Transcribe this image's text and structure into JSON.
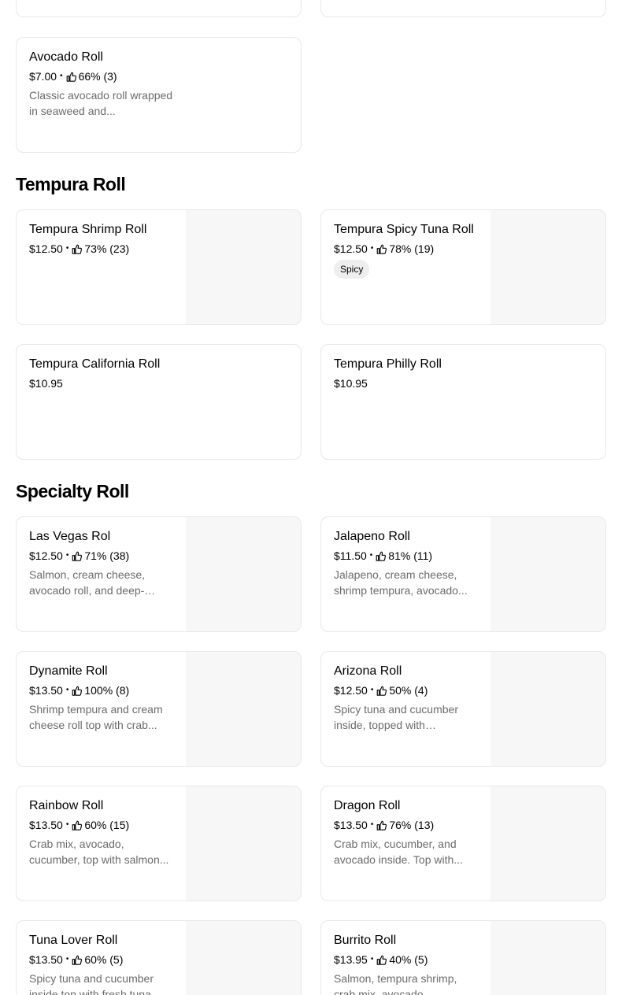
{
  "icons": {
    "rating": "thumbs-up-icon"
  },
  "top_partial_cards": [
    {},
    {}
  ],
  "prev_section_items": [
    {
      "name": "Avocado Roll",
      "price": "$7.00",
      "rating": "66% (3)",
      "description": "Classic avocado roll wrapped in seaweed and..."
    }
  ],
  "sections": [
    {
      "title": "Tempura Roll",
      "items": [
        {
          "name": "Tempura Shrimp Roll",
          "price": "$12.50",
          "rating": "73% (23)"
        },
        {
          "name": "Tempura Spicy Tuna Roll",
          "price": "$12.50",
          "rating": "78% (19)",
          "tag": "Spicy"
        },
        {
          "name": "Tempura California Roll",
          "price": "$10.95"
        },
        {
          "name": "Tempura Philly Roll",
          "price": "$10.95"
        }
      ]
    },
    {
      "title": "Specialty Roll",
      "items": [
        {
          "name": "Las Vegas Rol",
          "price": "$12.50",
          "rating": "71% (38)",
          "description": "Salmon, cream cheese, avocado roll, and deep-fried..."
        },
        {
          "name": "Jalapeno Roll",
          "price": "$11.50",
          "rating": "81% (11)",
          "description": "Jalapeno, cream cheese, shrimp tempura, avocado..."
        },
        {
          "name": "Dynamite Roll",
          "price": "$13.50",
          "rating": "100% (8)",
          "description": "Shrimp tempura and cream cheese roll top with crab..."
        },
        {
          "name": "Arizona Roll",
          "price": "$12.50",
          "rating": "50% (4)",
          "description": "Spicy tuna and cucumber inside, topped with avocado..."
        },
        {
          "name": "Rainbow Roll",
          "price": "$13.50",
          "rating": "60% (15)",
          "description": "Crab mix, avocado, cucumber, top with salmon..."
        },
        {
          "name": "Dragon Roll",
          "price": "$13.50",
          "rating": "76% (13)",
          "description": "Crab mix, cucumber, and avocado inside. Top with..."
        },
        {
          "name": "Tuna Lover Roll",
          "price": "$13.50",
          "rating": "60% (5)",
          "description": "Spicy tuna and cucumber inside top with fresh tuna..."
        },
        {
          "name": "Burrito Roll",
          "price": "$13.95",
          "rating": "40% (5)",
          "description": "Salmon, tempura shrimp, crab mix, avocado, jalapeno..."
        }
      ]
    }
  ]
}
